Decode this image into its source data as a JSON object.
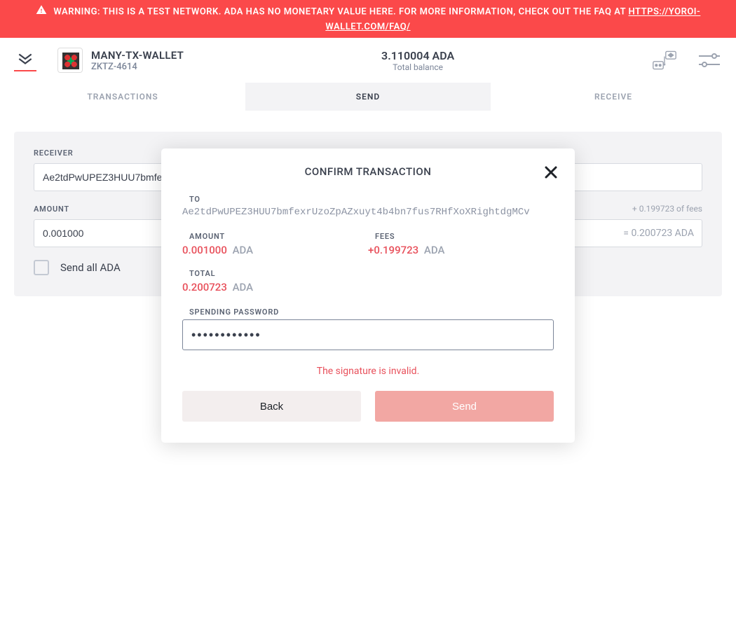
{
  "warning": {
    "text": "WARNING: THIS IS A TEST NETWORK. ADA HAS NO MONETARY VALUE HERE. FOR MORE INFORMATION, CHECK OUT THE FAQ AT ",
    "link": "HTTPS://YOROI-WALLET.COM/FAQ/"
  },
  "header": {
    "wallet_name": "MANY-TX-WALLET",
    "wallet_id": "ZKTZ-4614",
    "balance": "3.110004 ADA",
    "balance_label": "Total balance"
  },
  "tabs": {
    "transactions": "TRANSACTIONS",
    "send": "SEND",
    "receive": "RECEIVE"
  },
  "send_form": {
    "receiver_label": "RECEIVER",
    "receiver_value": "Ae2tdPwUPEZ3HUU7bmfe",
    "amount_label": "AMOUNT",
    "amount_value": "0.001000",
    "fees_hint": "+ 0.199723 of fees",
    "amount_suffix": "= 0.200723 ADA",
    "send_all_label": "Send all ADA"
  },
  "modal": {
    "title": "CONFIRM TRANSACTION",
    "to_label": "TO",
    "to_address": "Ae2tdPwUPEZ3HUU7bmfexrUzoZpAZxuyt4b4bn7fus7RHfXoXRightdgMCv",
    "amount_label": "AMOUNT",
    "amount_value": "0.001000",
    "amount_currency": "ADA",
    "fees_label": "FEES",
    "fees_value": "+0.199723",
    "fees_currency": "ADA",
    "total_label": "TOTAL",
    "total_value": "0.200723",
    "total_currency": "ADA",
    "password_label": "SPENDING PASSWORD",
    "password_value": "••••••••••••",
    "error": "The signature is invalid.",
    "back_button": "Back",
    "send_button": "Send"
  }
}
